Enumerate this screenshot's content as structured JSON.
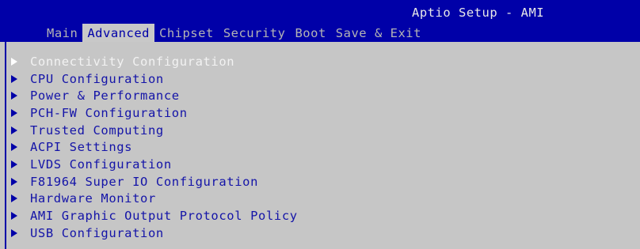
{
  "header": {
    "title": "Aptio Setup - AMI"
  },
  "tabs": [
    {
      "label": "Main",
      "active": false
    },
    {
      "label": "Advanced",
      "active": true
    },
    {
      "label": "Chipset",
      "active": false
    },
    {
      "label": "Security",
      "active": false
    },
    {
      "label": "Boot",
      "active": false
    },
    {
      "label": "Save & Exit",
      "active": false
    }
  ],
  "menu": {
    "items": [
      {
        "label": "Connectivity Configuration",
        "selected": true
      },
      {
        "label": "CPU Configuration",
        "selected": false
      },
      {
        "label": "Power & Performance",
        "selected": false
      },
      {
        "label": "PCH-FW Configuration",
        "selected": false
      },
      {
        "label": "Trusted Computing",
        "selected": false
      },
      {
        "label": "ACPI Settings",
        "selected": false
      },
      {
        "label": "LVDS Configuration",
        "selected": false
      },
      {
        "label": "F81964 Super IO Configuration",
        "selected": false
      },
      {
        "label": "Hardware Monitor",
        "selected": false
      },
      {
        "label": "AMI Graphic Output Protocol Policy",
        "selected": false
      },
      {
        "label": "USB Configuration",
        "selected": false
      }
    ]
  },
  "colors": {
    "header_bg": "#0000a8",
    "body_bg": "#c6c6c6",
    "item_text": "#1414a8",
    "selected_text": "#f2f2f2"
  }
}
